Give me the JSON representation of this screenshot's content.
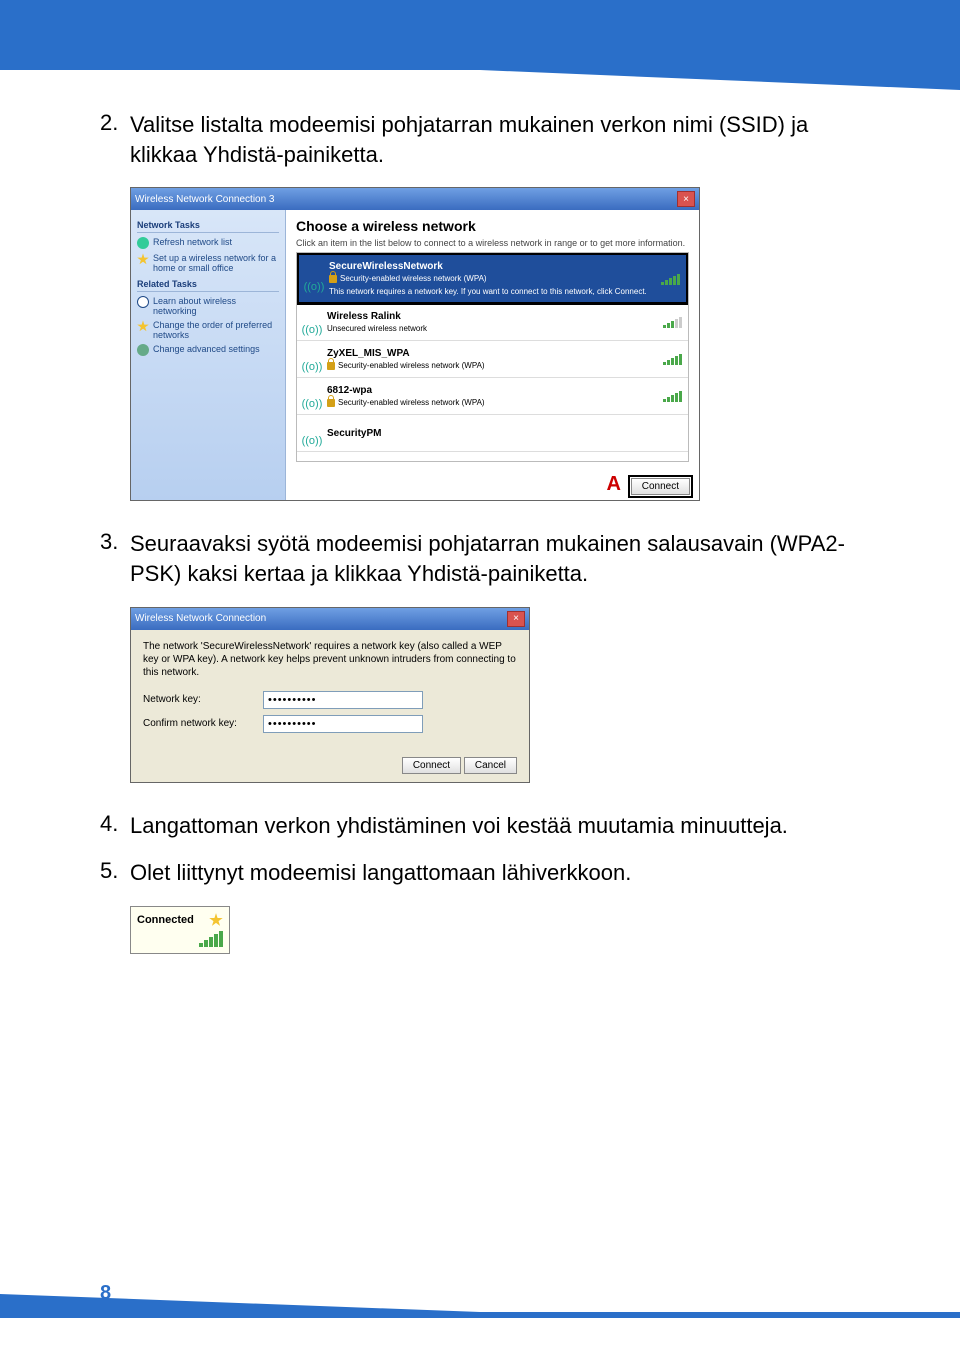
{
  "page_number": "8",
  "steps": {
    "s2": {
      "num": "2.",
      "text": "Valitse listalta modeemisi pohjatarran mukainen verkon nimi (SSID) ja klikkaa Yhdistä-painiketta."
    },
    "s3": {
      "num": "3.",
      "text": "Seuraavaksi syötä modeemisi pohjatarran mukainen salausavain (WPA2-PSK) kaksi kertaa ja klikkaa Yhdistä-painiketta."
    },
    "s4": {
      "num": "4.",
      "text": "Langattoman verkon yhdistäminen voi kestää muutamia minuutteja."
    },
    "s5": {
      "num": "5.",
      "text": "Olet liittynyt modeemisi langattomaan lähiverkkoon."
    }
  },
  "shot1": {
    "title": "Wireless Network Connection 3",
    "sidebar": {
      "head1": "Network Tasks",
      "items1": [
        "Refresh network list",
        "Set up a wireless network for a home or small office"
      ],
      "head2": "Related Tasks",
      "items2": [
        "Learn about wireless networking",
        "Change the order of preferred networks",
        "Change advanced settings"
      ]
    },
    "heading": "Choose a wireless network",
    "sub": "Click an item in the list below to connect to a wireless network in range or to get more information.",
    "networks": [
      {
        "name": "SecureWirelessNetwork",
        "sub": "Security-enabled wireless network (WPA)",
        "note": "This network requires a network key. If you want to connect to this network, click Connect.",
        "selected": true,
        "lock": true
      },
      {
        "name": "Wireless Ralink",
        "sub": "Unsecured wireless network",
        "lock": false
      },
      {
        "name": "ZyXEL_MIS_WPA",
        "sub": "Security-enabled wireless network (WPA)",
        "lock": true
      },
      {
        "name": "6812-wpa",
        "sub": "Security-enabled wireless network (WPA)",
        "lock": true
      },
      {
        "name": "SecurityPM",
        "sub": "",
        "lock": false
      }
    ],
    "a_marker": "A",
    "connect_btn": "Connect"
  },
  "shot2": {
    "title": "Wireless Network Connection",
    "desc": "The network 'SecureWirelessNetwork' requires a network key (also called a WEP key or WPA key). A network key helps prevent unknown intruders from connecting to this network.",
    "label1": "Network key:",
    "label2": "Confirm network key:",
    "value": "••••••••••",
    "connect": "Connect",
    "cancel": "Cancel"
  },
  "shot3": {
    "label": "Connected"
  }
}
